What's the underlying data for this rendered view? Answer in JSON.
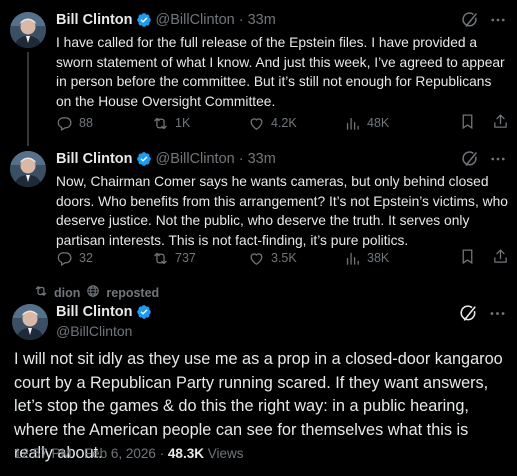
{
  "colors": {
    "background": "#000000",
    "text": "#e7e9ea",
    "muted": "#71767b",
    "verified": "#1d9bf0"
  },
  "tweets": [
    {
      "name": "Bill Clinton",
      "handle": "@BillClinton",
      "dot": "·",
      "time": "33m",
      "text": "I have called for the full release of the Epstein files. I have provided a sworn statement of what I know. And just this week, I’ve agreed to appear in person before the committee. But it’s still not enough for Republicans on the House Oversight Committee.",
      "replies": "88",
      "reposts": "1K",
      "likes": "4.2K",
      "views": "48K"
    },
    {
      "name": "Bill Clinton",
      "handle": "@BillClinton",
      "dot": "·",
      "time": "33m",
      "text": "Now, Chairman Comer says he wants cameras, but only behind closed doors. Who benefits from this arrangement? It’s not Epstein’s victims, who deserve justice. Not the public, who deserve the truth. It serves only partisan interests. This is not fact-finding, it’s pure politics.",
      "replies": "32",
      "reposts": "737",
      "likes": "3.5K",
      "views": "38K"
    }
  ],
  "repost_banner": {
    "user": "dion",
    "label": "reposted"
  },
  "main_tweet": {
    "name": "Bill Clinton",
    "handle": "@BillClinton",
    "text": "I will not sit idly as they use me as a prop in a closed-door kangaroo court by a Republican Party running scared. If they want answers, let’s stop the games & do this the right way: in a public hearing, where the American people can see for themselves what this is really about.",
    "time": "12:57 PM",
    "date": "Feb 6, 2026",
    "dot": "·",
    "views_count": "48.3K",
    "views_label": "Views"
  },
  "icons": {
    "verified": "verified-badge-icon",
    "grok": "grok-icon",
    "more": "more-icon",
    "reply": "reply-icon",
    "repost": "repost-icon",
    "like": "like-icon",
    "views": "views-icon",
    "bookmark": "bookmark-icon",
    "share": "share-icon",
    "globe": "globe-icon"
  }
}
